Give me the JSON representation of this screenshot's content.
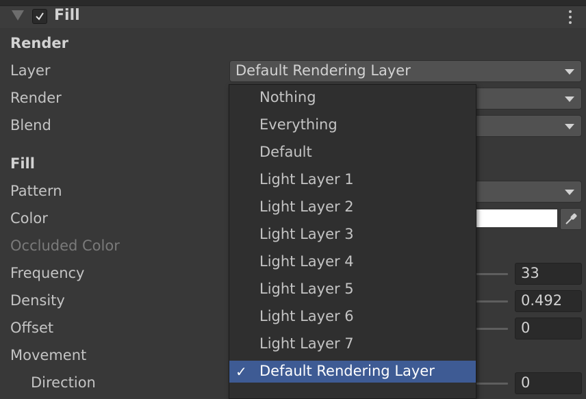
{
  "header": {
    "title": "Fill",
    "enabled": true
  },
  "sections": {
    "render": "Render",
    "fill": "Fill"
  },
  "labels": {
    "layer": "Layer",
    "render": "Render",
    "blend": "Blend",
    "pattern": "Pattern",
    "color": "Color",
    "occluded_color": "Occluded Color",
    "frequency": "Frequency",
    "density": "Density",
    "offset": "Offset",
    "movement": "Movement",
    "direction": "Direction"
  },
  "fields": {
    "layer_value": "Default Rendering Layer",
    "color_value": "#ffffff",
    "frequency_value": "33",
    "density_value": "0.492",
    "offset_value": "0",
    "direction_value": "0"
  },
  "dropdown": {
    "items": [
      "Nothing",
      "Everything",
      "Default",
      "Light Layer 1",
      "Light Layer 2",
      "Light Layer 3",
      "Light Layer 4",
      "Light Layer 5",
      "Light Layer 6",
      "Light Layer 7",
      "Default Rendering Layer"
    ],
    "selected_index": 10,
    "check": "✓"
  },
  "colors": {
    "background": "#383838",
    "selection": "#3e5b94",
    "field": "#515151"
  },
  "icons": {
    "foldout": "triangle-down-icon",
    "checkbox": "checkmark-icon",
    "menu": "kebab-menu-icon",
    "dropdown": "chevron-down-icon",
    "picker": "eyedropper-icon"
  }
}
